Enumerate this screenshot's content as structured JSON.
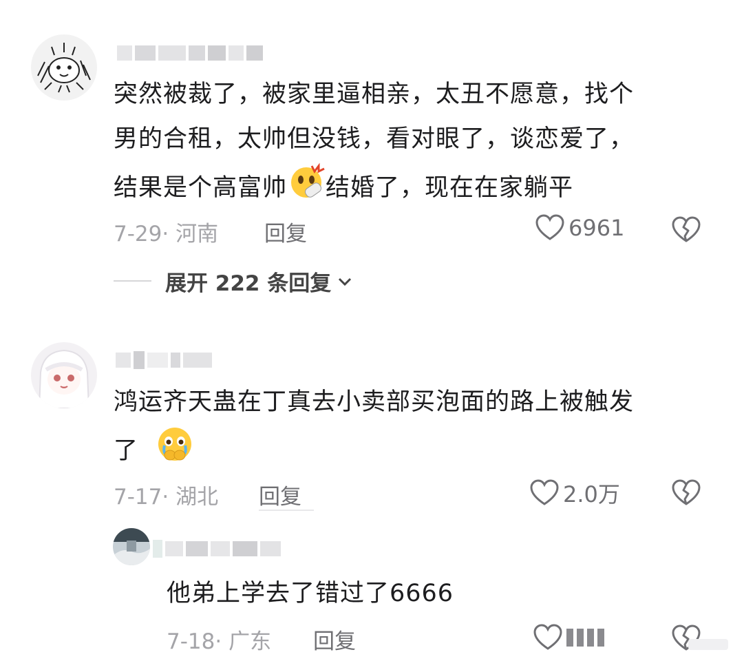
{
  "comments": [
    {
      "avatar": "cartoon-sketch-avatar",
      "lines": [
        "突然被裁了，被家里逼相亲，太丑不愿意，找个",
        "男的合租，太帅但没钱，看对眼了，谈恋爱了，",
        "结果是个高富帅"
      ],
      "line3_after": "结婚了，现在在家躺平",
      "emoji": "shocked-emoji",
      "date": "7-29",
      "location": "河南",
      "reply_label": "回复",
      "likes": "6961",
      "expand_label": "展开 222 条回复"
    },
    {
      "avatar": "anime-girl-avatar",
      "lines": [
        "鸿运齐天蛊在丁真去小卖部买泡面的路上被触发",
        "了"
      ],
      "emoji": "crying-cover-mouth-emoji",
      "date": "7-17",
      "location": "湖北",
      "reply_label": "回复",
      "likes": "2.0万"
    }
  ],
  "reply": {
    "avatar": "landscape-avatar",
    "text": "他弟上学去了错过了6666",
    "date": "7-18",
    "location": "广东",
    "reply_label": "回复"
  },
  "icons": {
    "like": "heart-icon",
    "dislike": "broken-heart-icon",
    "expand": "chevron-down-icon"
  },
  "colors": {
    "text": "#1d1d1f",
    "meta": "#a4a4a8",
    "icon": "#6f6f73"
  }
}
